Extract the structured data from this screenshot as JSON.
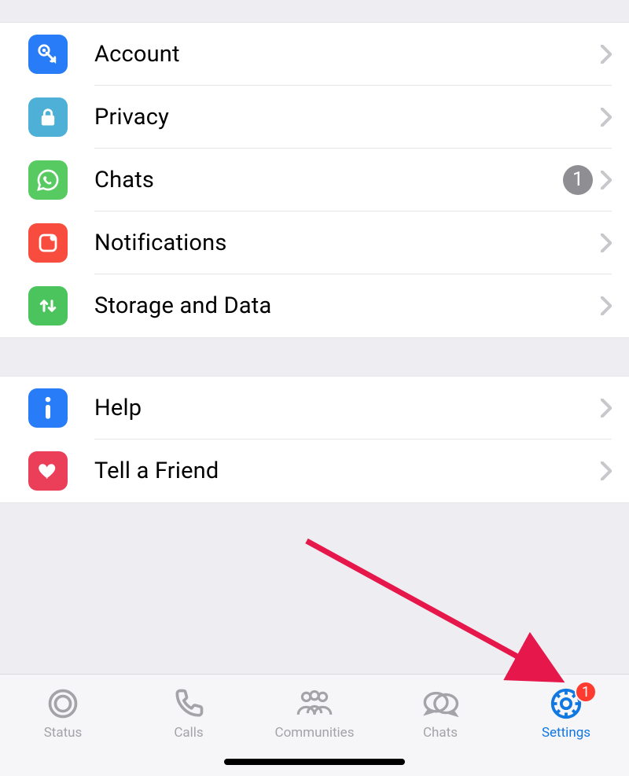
{
  "sections": [
    {
      "items": [
        {
          "key": "account",
          "label": "Account",
          "icon": "key-icon",
          "icon_bg": "#287cf7"
        },
        {
          "key": "privacy",
          "label": "Privacy",
          "icon": "lock-icon",
          "icon_bg": "#4eb0d7"
        },
        {
          "key": "chats",
          "label": "Chats",
          "icon": "whatsapp-icon",
          "icon_bg": "#57cb61",
          "badge": "1"
        },
        {
          "key": "notifications",
          "label": "Notifications",
          "icon": "notification-square-icon",
          "icon_bg": "#f84d3e"
        },
        {
          "key": "storage",
          "label": "Storage and Data",
          "icon": "storage-arrows-icon",
          "icon_bg": "#4bc45e"
        }
      ]
    },
    {
      "items": [
        {
          "key": "help",
          "label": "Help",
          "icon": "info-icon",
          "icon_bg": "#287cf7"
        },
        {
          "key": "tell",
          "label": "Tell a Friend",
          "icon": "heart-icon",
          "icon_bg": "#eb3f59"
        }
      ]
    }
  ],
  "tabs": {
    "status": {
      "label": "Status"
    },
    "calls": {
      "label": "Calls"
    },
    "communities": {
      "label": "Communities"
    },
    "chats": {
      "label": "Chats"
    },
    "settings": {
      "label": "Settings",
      "badge": "1",
      "active": true
    }
  },
  "colors": {
    "accent": "#1177e1",
    "chevron": "#c7c7cc",
    "tab_inactive": "#a4a4a8",
    "badge_gray": "#8e8e93",
    "badge_red": "#ff3b30"
  }
}
